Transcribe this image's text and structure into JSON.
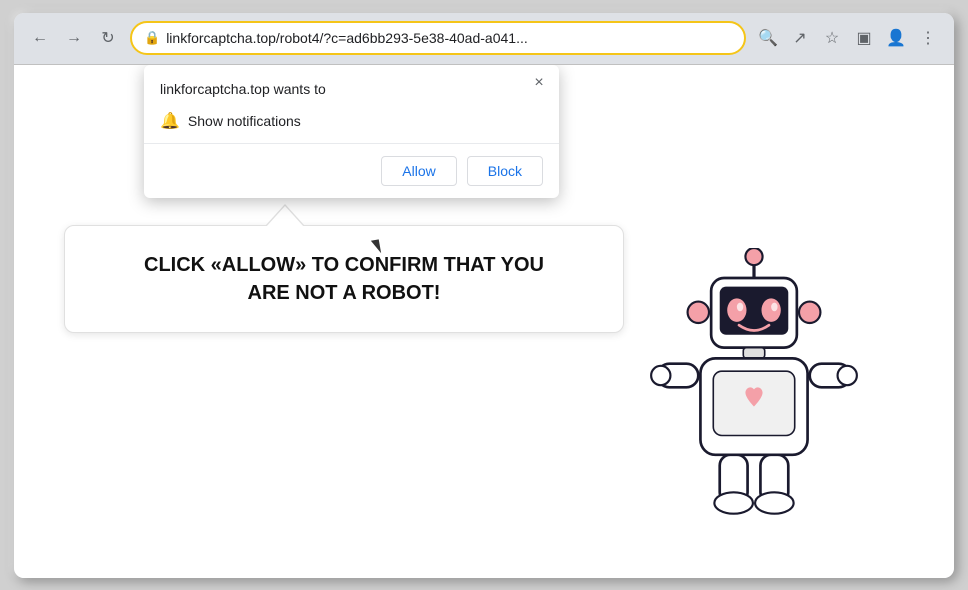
{
  "browser": {
    "url": "linkforcaptcha.top/robot4/?c=ad6bb293-5e38-40ad-a041...",
    "url_display": "linkforcaptcha.top/robot4/?c=ad6bb293-5e38-40ad-a041...",
    "nav": {
      "back_label": "←",
      "forward_label": "→",
      "reload_label": "↻"
    },
    "toolbar_icons": {
      "search": "🔍",
      "share": "↗",
      "bookmark": "☆",
      "extension": "▣",
      "account": "👤",
      "menu": "⋮"
    }
  },
  "notification_popup": {
    "site": "linkforcaptcha.top wants to",
    "permission": "Show notifications",
    "close_label": "×",
    "allow_label": "Allow",
    "block_label": "Block"
  },
  "page_content": {
    "bubble_line1": "CLICK «ALLOW» TO CONFIRM THAT YOU",
    "bubble_line2": "ARE NOT A ROBOT!"
  }
}
